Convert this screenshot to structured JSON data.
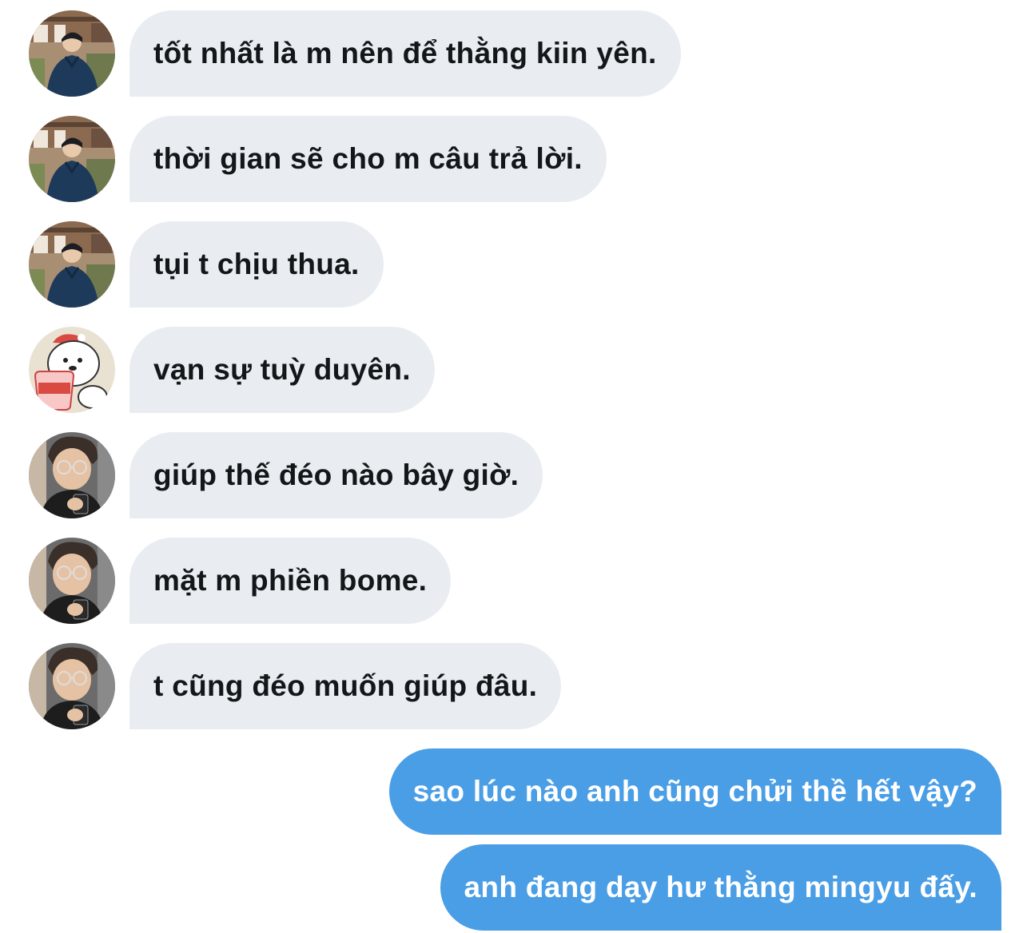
{
  "colors": {
    "incoming_bubble": "#e9edf1",
    "incoming_text": "#14171a",
    "outgoing_bubble": "#4a9ee6",
    "outgoing_text": "#ffffff"
  },
  "messages": [
    {
      "direction": "incoming",
      "avatar": "avatar-guy-dark-coat-icon",
      "text": "tốt nhất là m nên để thằng kiin yên."
    },
    {
      "direction": "incoming",
      "avatar": "avatar-guy-dark-coat-icon",
      "text": "thời gian sẽ cho m câu trả lời."
    },
    {
      "direction": "incoming",
      "avatar": "avatar-guy-dark-coat-icon",
      "text": "tụi t chịu thua."
    },
    {
      "direction": "incoming",
      "avatar": "avatar-polar-bear-icon",
      "text": "vạn sự tuỳ duyên."
    },
    {
      "direction": "incoming",
      "avatar": "avatar-guy-glasses-phone-icon",
      "text": "giúp thế đéo nào bây giờ."
    },
    {
      "direction": "incoming",
      "avatar": "avatar-guy-glasses-phone-icon",
      "text": "mặt m phiền bome."
    },
    {
      "direction": "incoming",
      "avatar": "avatar-guy-glasses-phone-icon",
      "text": "t cũng đéo muốn giúp đâu."
    },
    {
      "direction": "outgoing",
      "text": "sao lúc nào anh cũng chửi thề hết vậy?"
    },
    {
      "direction": "outgoing",
      "text": "anh đang dạy hư thằng mingyu đấy."
    }
  ]
}
